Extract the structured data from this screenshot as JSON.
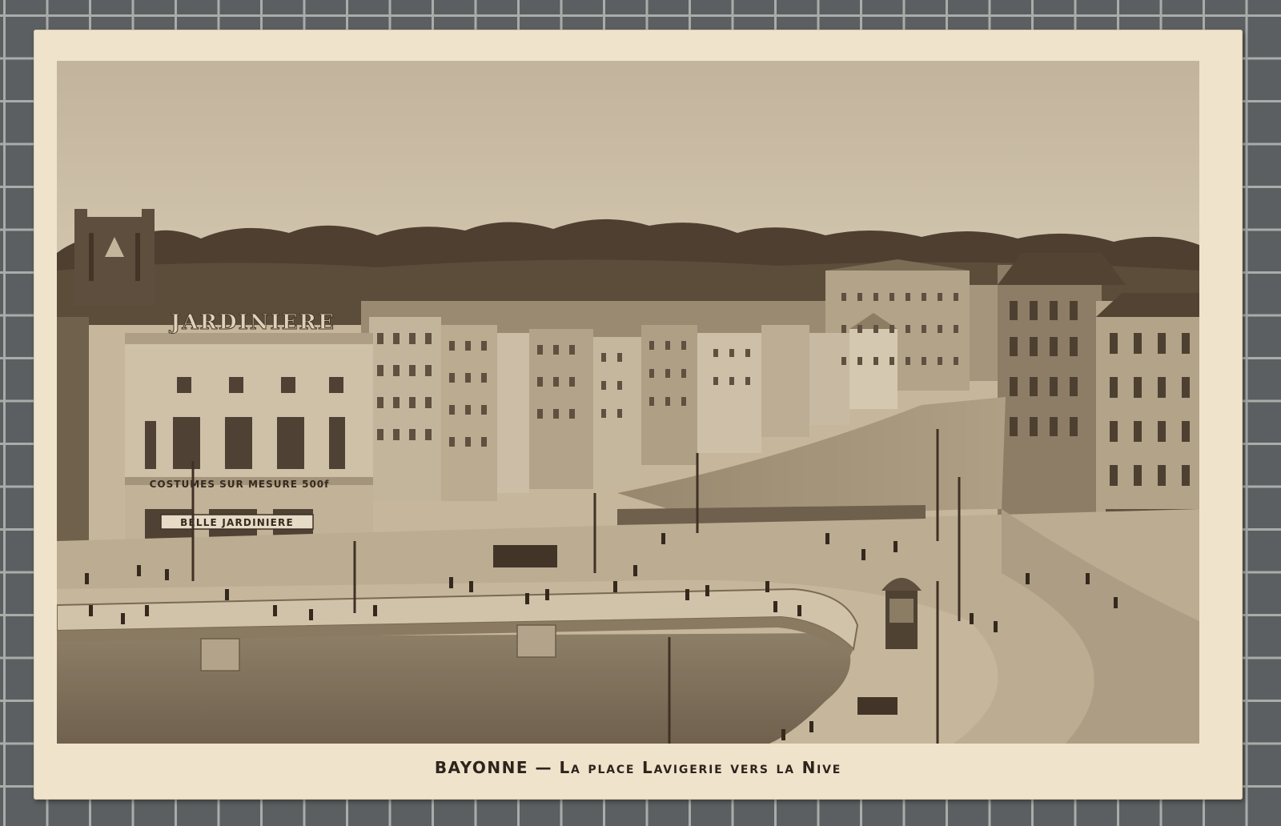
{
  "postcard": {
    "caption_city": "BAYONNE",
    "caption_dash": "—",
    "caption_text": "La place Lavigerie vers la Nive",
    "sign_top": "JARDINIERE",
    "sign_middle": "COSTUMES SUR MESURE 500f",
    "sign_bottom": "BELLE JARDINIERE"
  },
  "colors": {
    "sepia_dark": "#3a2e24",
    "sepia_mid": "#8a7a62",
    "sepia_light": "#d8ccb4",
    "card": "#efe3cc",
    "background_grid": "#5c5f61"
  }
}
